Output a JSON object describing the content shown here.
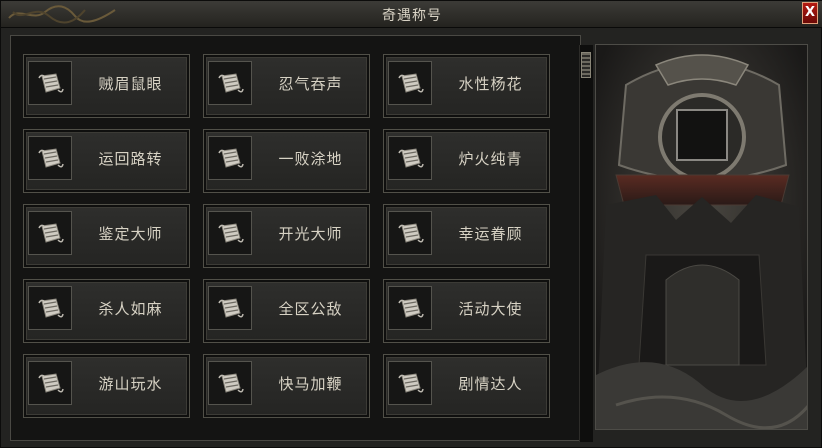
{
  "window": {
    "title": "奇遇称号",
    "close_label": "X"
  },
  "titles": [
    {
      "label": "贼眉鼠眼"
    },
    {
      "label": "忍气吞声"
    },
    {
      "label": "水性杨花"
    },
    {
      "label": "运回路转"
    },
    {
      "label": "一败涂地"
    },
    {
      "label": "炉火纯青"
    },
    {
      "label": "鉴定大师"
    },
    {
      "label": "开光大师"
    },
    {
      "label": "幸运眷顾"
    },
    {
      "label": "杀人如麻"
    },
    {
      "label": "全区公敌"
    },
    {
      "label": "活动大使"
    },
    {
      "label": "游山玩水"
    },
    {
      "label": "快马加鞭"
    },
    {
      "label": "剧情达人"
    }
  ],
  "icons": {
    "title_item": "scroll-icon",
    "close": "close-icon"
  },
  "colors": {
    "accent_close": "#9a140d",
    "text": "#d7d2c4",
    "border": "#515048"
  }
}
